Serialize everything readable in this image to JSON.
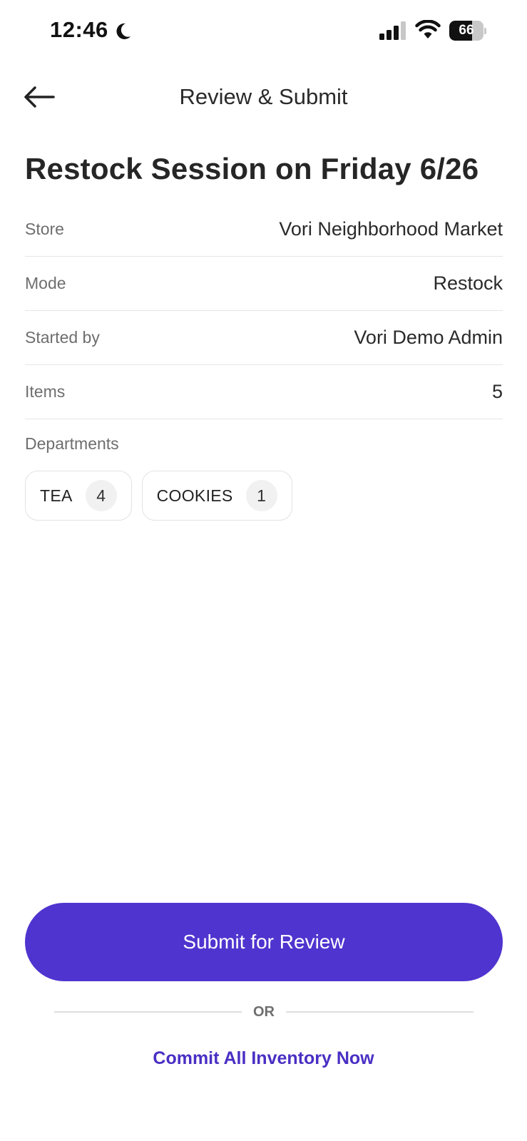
{
  "status_bar": {
    "time": "12:46",
    "battery_level": "66",
    "battery_fraction": 0.66,
    "icons": [
      "moon-icon",
      "signal-icon",
      "wifi-icon",
      "battery-icon"
    ]
  },
  "header": {
    "title": "Review & Submit",
    "back_icon": "arrow-left-icon"
  },
  "session": {
    "title": "Restock Session on Friday 6/26",
    "details": [
      {
        "label": "Store",
        "value": "Vori Neighborhood Market"
      },
      {
        "label": "Mode",
        "value": "Restock"
      },
      {
        "label": "Started by",
        "value": "Vori Demo Admin"
      },
      {
        "label": "Items",
        "value": "5"
      }
    ],
    "departments_label": "Departments",
    "departments": [
      {
        "name": "TEA",
        "count": "4"
      },
      {
        "name": "COOKIES",
        "count": "1"
      }
    ]
  },
  "actions": {
    "submit_label": "Submit for Review",
    "or_label": "OR",
    "commit_label": "Commit All Inventory Now"
  },
  "colors": {
    "accent": "#5034cf",
    "link": "#4a2fc4",
    "label": "#6e6e6e",
    "divider": "#e6e6e6"
  }
}
